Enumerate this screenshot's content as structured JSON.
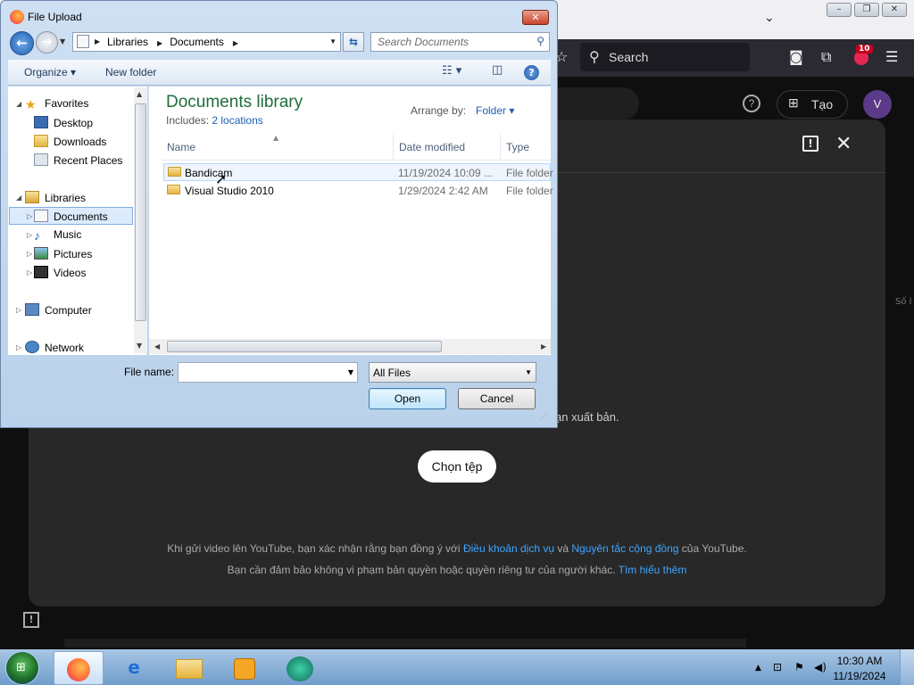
{
  "browser": {
    "search_placeholder": "Search",
    "addon_badge": "10",
    "chevron": "⌄",
    "window_controls": [
      "–",
      "❐",
      "✕"
    ]
  },
  "youtube": {
    "help_icon": "?",
    "create_label": "Tạo",
    "avatar_letter": "V",
    "publish_text": "ạn xuất bản.",
    "select_files": "Chọn tệp",
    "terms_line1_prefix": "Khi gửi video lên YouTube, bạn xác nhận rằng bạn đồng ý với ",
    "terms_link1": "Điều khoản dịch vụ",
    "terms_line1_mid": " và ",
    "terms_link2": "Nguyên tắc cộng đồng",
    "terms_line1_suffix": " của YouTube.",
    "terms_line2_prefix": "Bạn cần đảm bảo không vi phạm bản quyền hoặc quyền riêng tư của người khác. ",
    "terms_link3": "Tìm hiểu thêm",
    "side_text": "Số l"
  },
  "dialog": {
    "title": "File Upload",
    "breadcrumb": [
      "Libraries",
      "Documents"
    ],
    "search_placeholder": "Search Documents",
    "organize": "Organize ▾",
    "new_folder": "New folder",
    "library_title": "Documents library",
    "includes_label": "Includes:",
    "includes_link": "2 locations",
    "arrange_label": "Arrange by:",
    "arrange_value": "Folder ▾",
    "columns": [
      "Name",
      "Date modified",
      "Type"
    ],
    "files": [
      {
        "name": "Bandicam",
        "date": "11/19/2024 10:09 ...",
        "type": "File folder"
      },
      {
        "name": "Visual Studio 2010",
        "date": "1/29/2024 2:42 AM",
        "type": "File folder"
      }
    ],
    "nav": {
      "favorites": "Favorites",
      "desktop": "Desktop",
      "downloads": "Downloads",
      "recent": "Recent Places",
      "libraries": "Libraries",
      "documents": "Documents",
      "music": "Music",
      "pictures": "Pictures",
      "videos": "Videos",
      "computer": "Computer",
      "network": "Network"
    },
    "file_name_label": "File name:",
    "file_name_value": "",
    "file_type": "All Files",
    "open_button": "Open",
    "cancel_button": "Cancel"
  },
  "taskbar": {
    "time": "10:30 AM",
    "date": "11/19/2024"
  }
}
